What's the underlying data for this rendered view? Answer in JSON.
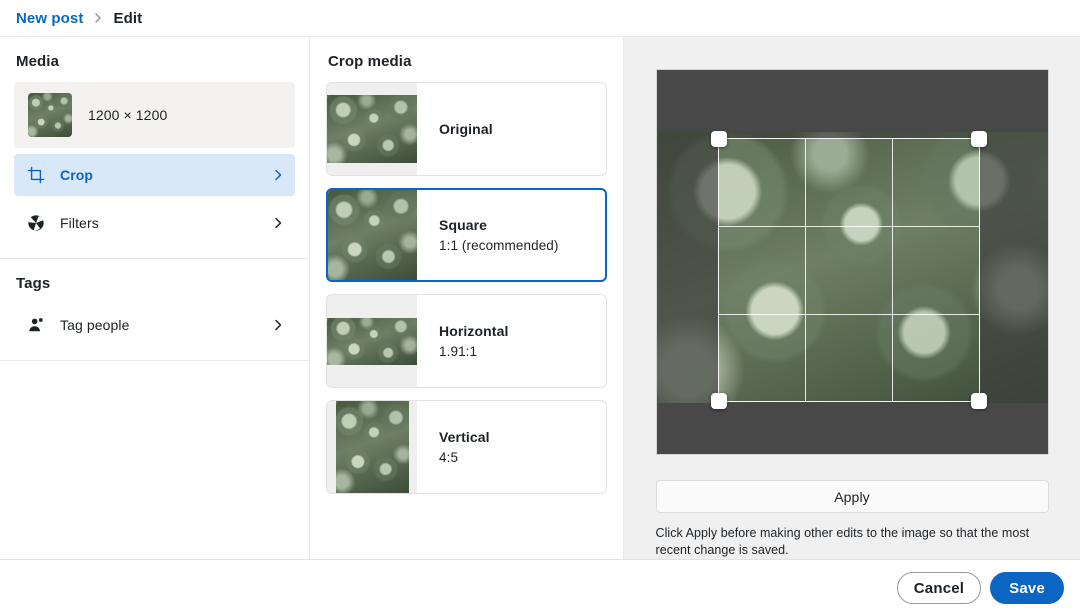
{
  "breadcrumb": {
    "parent": "New post",
    "separator": "›",
    "current": "Edit"
  },
  "sidebar": {
    "media_section_title": "Media",
    "media": {
      "dimensions": "1200 × 1200",
      "thumbnail_icon": "image-thumbnail"
    },
    "items": [
      {
        "label": "Crop",
        "icon": "crop-icon",
        "selected": true,
        "chevron": "chevron-right-icon"
      },
      {
        "label": "Filters",
        "icon": "aperture-icon",
        "selected": false,
        "chevron": "chevron-right-icon"
      }
    ],
    "tags_section_title": "Tags",
    "tags_items": [
      {
        "label": "Tag people",
        "icon": "tag-person-icon",
        "chevron": "chevron-right-icon"
      }
    ]
  },
  "middle": {
    "title": "Crop media",
    "options": [
      {
        "name": "Original",
        "ratio": "",
        "selected": false
      },
      {
        "name": "Square",
        "ratio": "1:1 (recommended)",
        "selected": true
      },
      {
        "name": "Horizontal",
        "ratio": "1.91:1",
        "selected": false
      },
      {
        "name": "Vertical",
        "ratio": "4:5",
        "selected": false
      }
    ]
  },
  "preview": {
    "apply_label": "Apply",
    "hint": "Click Apply before making other edits to the image so that the most recent change is saved.",
    "handles": [
      "top-left",
      "top-right",
      "bottom-left",
      "bottom-right"
    ]
  },
  "footer": {
    "cancel_label": "Cancel",
    "save_label": "Save"
  },
  "colors": {
    "accent": "#0a66c2",
    "selected_row_bg": "#d9e8f8",
    "panel_bg": "#f0f0f0",
    "media_card_bg": "#f3f2f0",
    "dim_overlay": "#5c5c5c"
  }
}
